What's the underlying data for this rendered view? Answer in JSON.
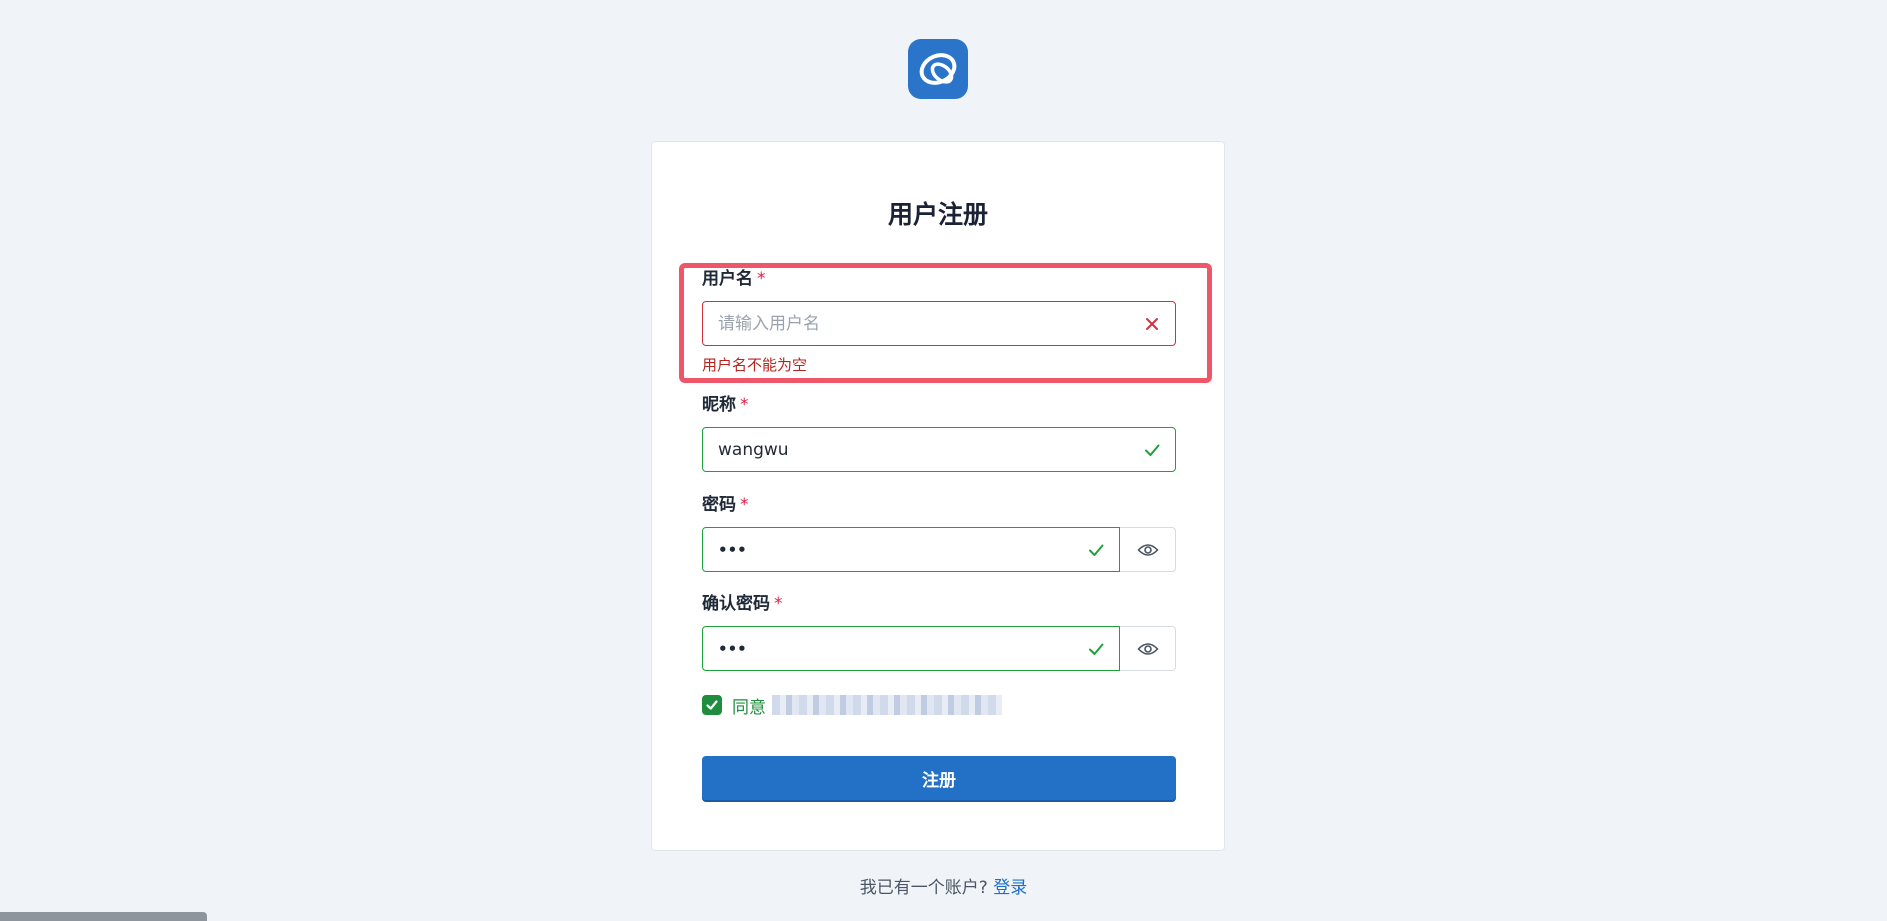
{
  "logo": {
    "icon": "app-logo-icon",
    "color": "#2a74c9"
  },
  "form": {
    "title": "用户注册",
    "username": {
      "label": "用户名",
      "required_mark": "*",
      "value": "",
      "placeholder": "请输入用户名",
      "error": "用户名不能为空",
      "status_icon": "error-x-icon"
    },
    "nickname": {
      "label": "昵称",
      "required_mark": "*",
      "value": "wangwu",
      "status_icon": "check-icon"
    },
    "password": {
      "label": "密码",
      "required_mark": "*",
      "value": "•••",
      "status_icon": "check-icon",
      "toggle_icon": "eye-icon"
    },
    "confirm_password": {
      "label": "确认密码",
      "required_mark": "*",
      "value": "•••",
      "status_icon": "check-icon",
      "toggle_icon": "eye-icon"
    },
    "agreement": {
      "checked": true,
      "label": "同意"
    },
    "submit_label": "注册"
  },
  "footer": {
    "text": "我已有一个账户?",
    "link_label": "登录"
  },
  "colors": {
    "primary": "#2370c7",
    "error": "#d6303f",
    "success": "#1ea03a",
    "highlight": "#f0566a"
  }
}
